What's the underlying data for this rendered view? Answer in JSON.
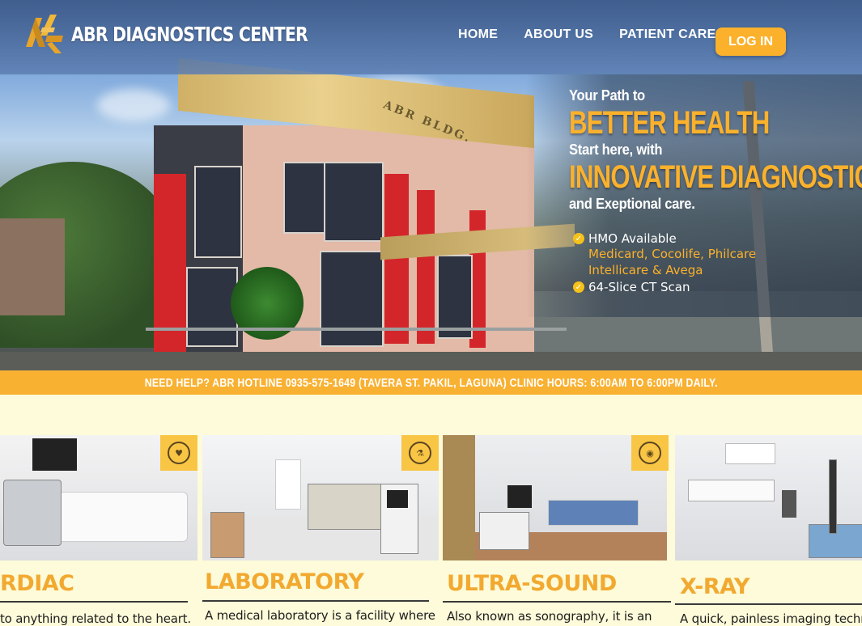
{
  "site": {
    "name": "ABR DIAGNOSTICS CENTER",
    "logo_icon": "abr-logo-icon"
  },
  "nav": {
    "home": "HOME",
    "about": "ABOUT US",
    "patient_care": "PATIENT CARE",
    "login": "LOG IN"
  },
  "hero": {
    "line1": "Your Path to",
    "line2": "BETTER HEALTH",
    "line3": "Start here, with",
    "line4": "INNOVATIVE DIAGNOSTICS",
    "line5": "and Exeptional care.",
    "building_sign": "ABR BLDG.",
    "features": [
      {
        "label": "HMO Available",
        "sub1": "Medicard, Cocolife, Philcare",
        "sub2": "Intellicare & Avega"
      },
      {
        "label": "64-Slice CT Scan"
      }
    ]
  },
  "hotline": {
    "text": "NEED HELP? ABR HOTLINE  0935-575-1649 (TAVERA ST. PAKIL, LAGUNA)  CLINIC HOURS: 6:00AM TO 6:00PM DAILY."
  },
  "services": [
    {
      "title": "RDIAC",
      "desc": "to anything related to the heart.",
      "icon": "heart-monitor-icon"
    },
    {
      "title": "LABORATORY",
      "desc": "A medical laboratory is a facility where",
      "icon": "microscope-icon"
    },
    {
      "title": "ULTRA-SOUND",
      "desc": "Also known as sonography, it is an",
      "icon": "ultrasound-icon"
    },
    {
      "title": "X-RAY",
      "desc": "A quick, painless imaging techni",
      "icon": "xray-icon"
    }
  ],
  "colors": {
    "accent": "#fbb12b",
    "nav_bg": "#3e5c8c",
    "page_bg": "#fdfbd9",
    "title_orange": "#f2a930"
  }
}
